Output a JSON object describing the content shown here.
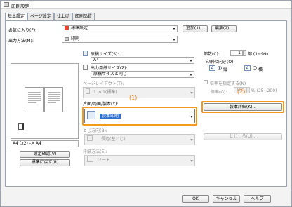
{
  "window": {
    "title": "印刷設定"
  },
  "tabs": [
    {
      "label": "基本設定"
    },
    {
      "label": "ページ設定"
    },
    {
      "label": "仕上げ"
    },
    {
      "label": "印刷品質"
    }
  ],
  "favorites": {
    "label": "お気に入り(F):",
    "value": "標準設定",
    "add_button": "追加(1)...",
    "edit_button": "編集(2)..."
  },
  "output": {
    "label": "出力方法(M):",
    "value": "印刷"
  },
  "preview": {
    "caption": "A4 (x2) -> A4",
    "confirm_button": "設定確認(V)",
    "defaults_button": "標準に戻す(R)"
  },
  "original_size": {
    "label": "原稿サイズ(S):",
    "value": "A4"
  },
  "paper_size": {
    "label": "出力用紙サイズ(Z):",
    "value": "原稿サイズと同じ"
  },
  "copies": {
    "label": "部数(C):",
    "value": "1",
    "suffix": "部 (1~99)"
  },
  "orientation": {
    "label": "印刷の向き(O)",
    "portrait_icon": "A",
    "portrait_label": "縦",
    "landscape_icon": "A",
    "landscape_label": "横"
  },
  "page_layout": {
    "label": "ページレイアウト(T):",
    "value": "1 in 1(標準)"
  },
  "manual_scaling": {
    "label": "倍率を指定する(N)",
    "ratio_label": "倍率(G):",
    "ratio_value": "100",
    "ratio_suffix": "% (25~200)"
  },
  "print_style": {
    "label": "片面/両面/製本(Y):",
    "value": "製本印刷"
  },
  "booklet_button": "製本詳細(K)...",
  "binding": {
    "label": "とじ方向(B):",
    "value": "長辺(左とじ)",
    "margin_button": "とじしろ(U)..."
  },
  "paper_output": {
    "label": "排紙方法(E):",
    "value": "ソート"
  },
  "callouts": {
    "one": "(1)",
    "two": "(2)"
  },
  "footer": {
    "ok": "OK",
    "cancel": "キャンセル",
    "help": "ヘルプ"
  }
}
